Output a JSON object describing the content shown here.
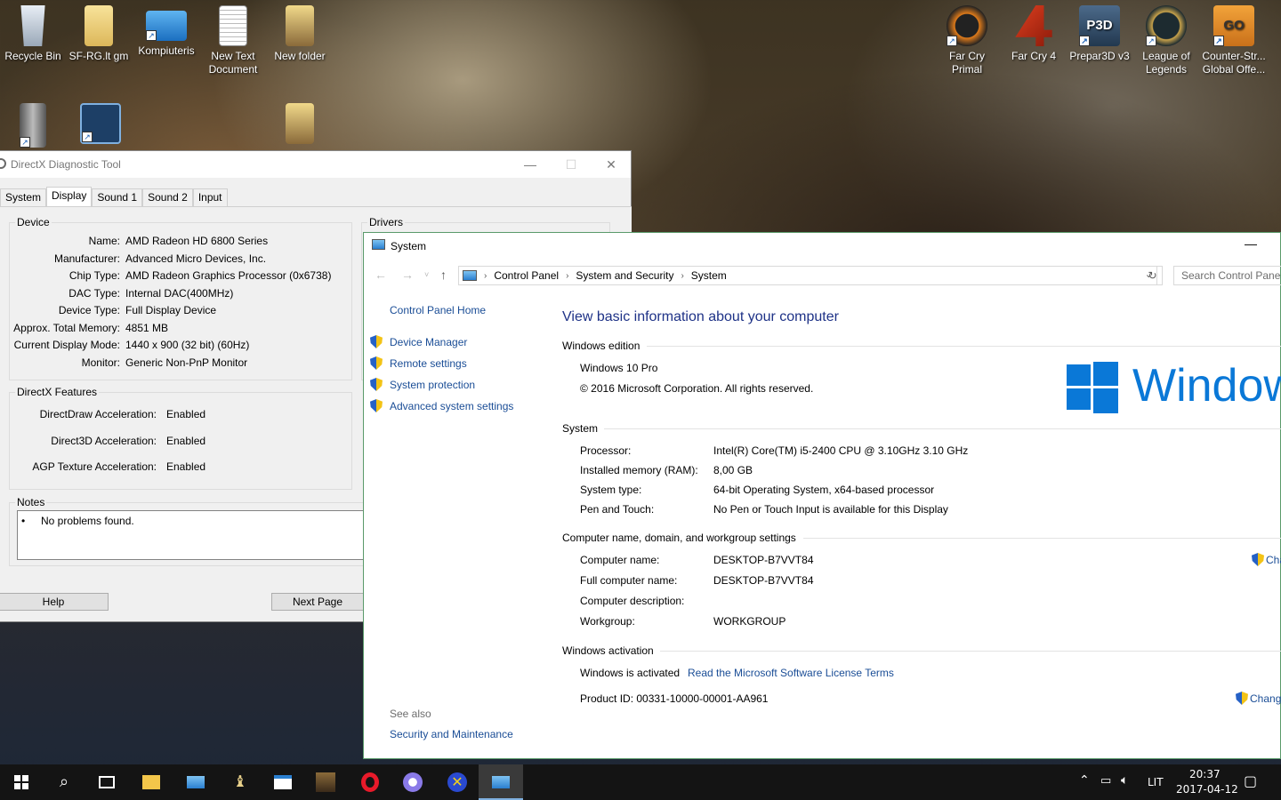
{
  "desktop": {
    "icons": [
      {
        "label": "Recycle Bin"
      },
      {
        "label": "SF-RG.lt gm"
      },
      {
        "label": "Kompiuteris"
      },
      {
        "label": "New Text Document"
      },
      {
        "label": "New folder"
      },
      {
        "label": "Far Cry Primal"
      },
      {
        "label": "Far Cry 4"
      },
      {
        "label": "Prepar3D v3"
      },
      {
        "label": "League of Legends"
      },
      {
        "label": "Counter-Str... Global Offe..."
      }
    ]
  },
  "dxdiag": {
    "title": "DirectX Diagnostic Tool",
    "tabs": [
      "System",
      "Display",
      "Sound 1",
      "Sound 2",
      "Input"
    ],
    "device_group": "Device",
    "drivers_group": "Drivers",
    "device": [
      {
        "k": "Name:",
        "v": "AMD Radeon HD 6800 Series"
      },
      {
        "k": "Manufacturer:",
        "v": "Advanced Micro Devices, Inc."
      },
      {
        "k": "Chip Type:",
        "v": "AMD Radeon Graphics Processor (0x6738)"
      },
      {
        "k": "DAC Type:",
        "v": "Internal DAC(400MHz)"
      },
      {
        "k": "Device Type:",
        "v": "Full Display Device"
      },
      {
        "k": "Approx. Total Memory:",
        "v": "4851 MB"
      },
      {
        "k": "Current Display Mode:",
        "v": "1440 x 900 (32 bit) (60Hz)"
      },
      {
        "k": "Monitor:",
        "v": "Generic Non-PnP Monitor"
      }
    ],
    "features_group": "DirectX Features",
    "features": [
      {
        "k": "DirectDraw Acceleration:",
        "v": "Enabled"
      },
      {
        "k": "Direct3D Acceleration:",
        "v": "Enabled"
      },
      {
        "k": "AGP Texture Acceleration:",
        "v": "Enabled"
      }
    ],
    "notes_group": "Notes",
    "notes": "No problems found.",
    "help_button": "Help",
    "next_button": "Next Page"
  },
  "system": {
    "title": "System",
    "breadcrumb": [
      "Control Panel",
      "System and Security",
      "System"
    ],
    "search_placeholder": "Search Control Panel",
    "left_nav": {
      "home": "Control Panel Home",
      "links": [
        "Device Manager",
        "Remote settings",
        "System protection",
        "Advanced system settings"
      ],
      "see_also": "See also",
      "security": "Security and Maintenance"
    },
    "heading": "View basic information about your computer",
    "edition_head": "Windows edition",
    "edition": "Windows 10 Pro",
    "copyright": "© 2016 Microsoft Corporation. All rights reserved.",
    "logo_text": "Window",
    "system_head": "System",
    "system_rows": [
      {
        "k": "Processor:",
        "v": "Intel(R) Core(TM) i5-2400 CPU @ 3.10GHz   3.10 GHz"
      },
      {
        "k": "Installed memory (RAM):",
        "v": "8,00 GB"
      },
      {
        "k": "System type:",
        "v": "64-bit Operating System, x64-based processor"
      },
      {
        "k": "Pen and Touch:",
        "v": "No Pen or Touch Input is available for this Display"
      }
    ],
    "name_head": "Computer name, domain, and workgroup settings",
    "name_rows": [
      {
        "k": "Computer name:",
        "v": "DESKTOP-B7VVT84"
      },
      {
        "k": "Full computer name:",
        "v": "DESKTOP-B7VVT84"
      },
      {
        "k": "Computer description:",
        "v": ""
      },
      {
        "k": "Workgroup:",
        "v": "WORKGROUP"
      }
    ],
    "change_settings": "Cha",
    "activation_head": "Windows activation",
    "activated": "Windows is activated",
    "license_link": "Read the Microsoft Software License Terms",
    "product_id": "Product ID:  00331-10000-00001-AA961",
    "change_key": "Chang"
  },
  "taskbar": {
    "lang": "LIT",
    "time": "20:37",
    "date": "2017-04-12"
  }
}
